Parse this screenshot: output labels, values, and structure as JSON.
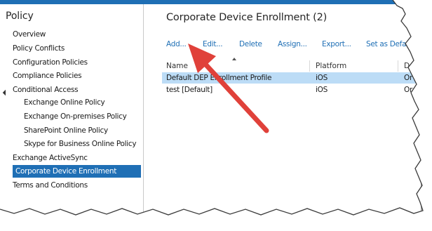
{
  "sidebar": {
    "title": "Policy",
    "items": [
      {
        "label": "Overview"
      },
      {
        "label": "Policy Conflicts"
      },
      {
        "label": "Configuration Policies"
      },
      {
        "label": "Compliance Policies"
      },
      {
        "label": "Conditional Access",
        "expanded": true
      },
      {
        "label": "Exchange Online Policy"
      },
      {
        "label": "Exchange On-premises Policy"
      },
      {
        "label": "SharePoint Online Policy"
      },
      {
        "label": "Skype for Business Online Policy"
      },
      {
        "label": "Exchange ActiveSync"
      },
      {
        "label": "Corporate Device Enrollment",
        "selected": true
      },
      {
        "label": "Terms and Conditions"
      }
    ]
  },
  "main": {
    "title": "Corporate Device Enrollment (2)",
    "actions": [
      "Add...",
      "Edit...",
      "Delete",
      "Assign...",
      "Export...",
      "Set as Default"
    ],
    "columns": [
      "Name",
      "Platform",
      "D"
    ],
    "rows": [
      {
        "name": "Default DEP Enrollment Profile",
        "platform": "iOS",
        "d": "Or",
        "selected": true
      },
      {
        "name": "test [Default]",
        "platform": "iOS",
        "d": "Or"
      }
    ]
  },
  "colors": {
    "accent": "#1f6fb5",
    "selection": "#bcdcf6",
    "arrow": "#e0413a"
  }
}
